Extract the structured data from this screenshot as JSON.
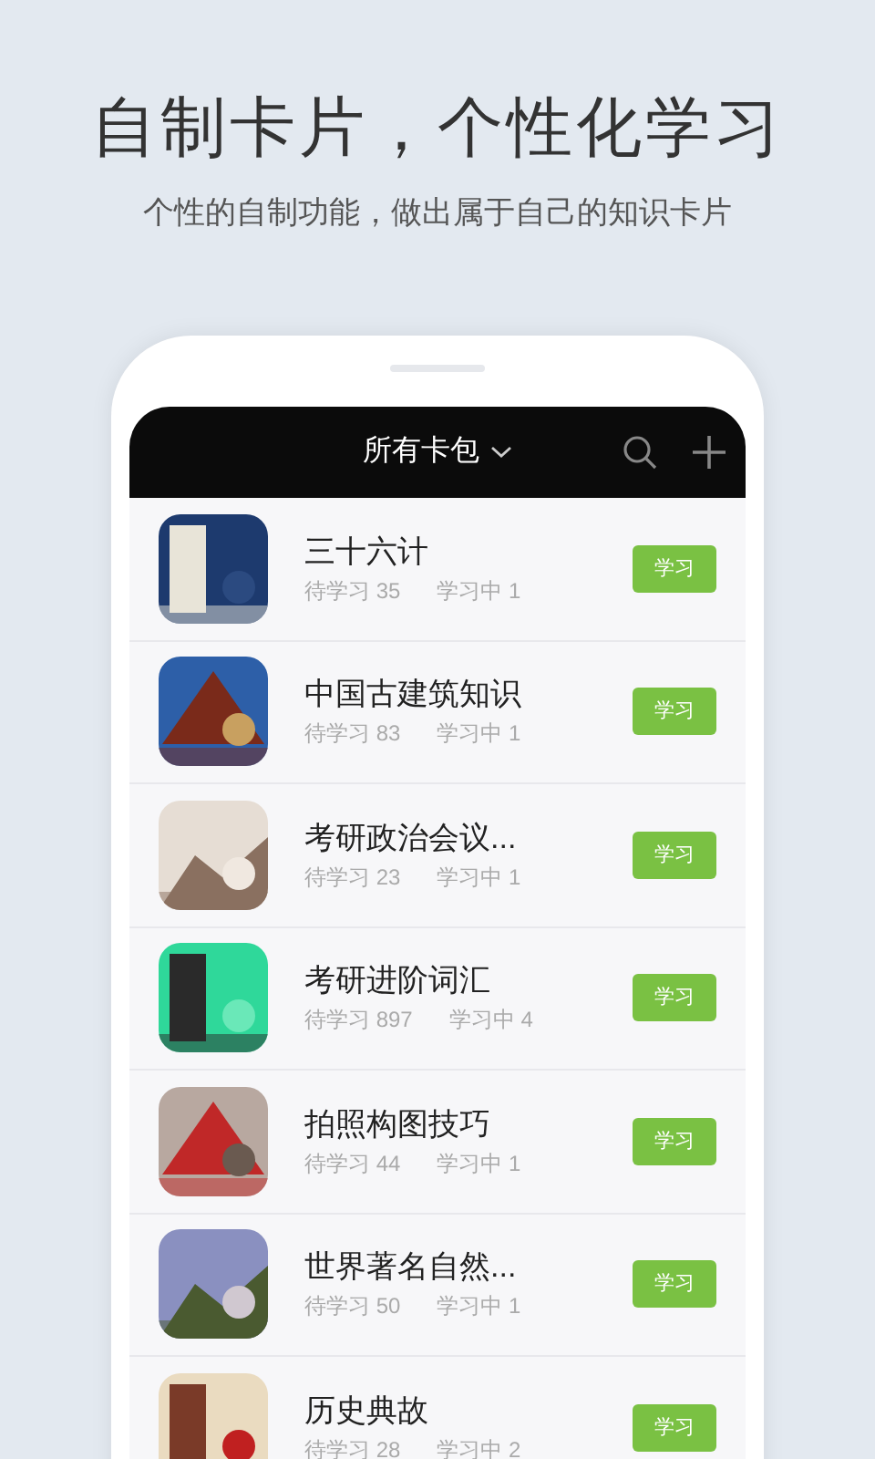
{
  "headline": "自制卡片，个性化学习",
  "subheadline": "个性的自制功能，做出属于自己的知识卡片",
  "header": {
    "title": "所有卡包"
  },
  "decks": [
    {
      "title": "三十六计",
      "pending": "待学习 35",
      "learning": "学习中 1",
      "action": "学习"
    },
    {
      "title": "中国古建筑知识",
      "pending": "待学习 83",
      "learning": "学习中 1",
      "action": "学习"
    },
    {
      "title": "考研政治会议...",
      "pending": "待学习 23",
      "learning": "学习中 1",
      "action": "学习"
    },
    {
      "title": "考研进阶词汇",
      "pending": "待学习 897",
      "learning": "学习中 4",
      "action": "学习"
    },
    {
      "title": "拍照构图技巧",
      "pending": "待学习 44",
      "learning": "学习中 1",
      "action": "学习"
    },
    {
      "title": "世界著名自然...",
      "pending": "待学习 50",
      "learning": "学习中 1",
      "action": "学习"
    },
    {
      "title": "历史典故",
      "pending": "待学习 28",
      "learning": "学习中 2",
      "action": "学习"
    }
  ]
}
